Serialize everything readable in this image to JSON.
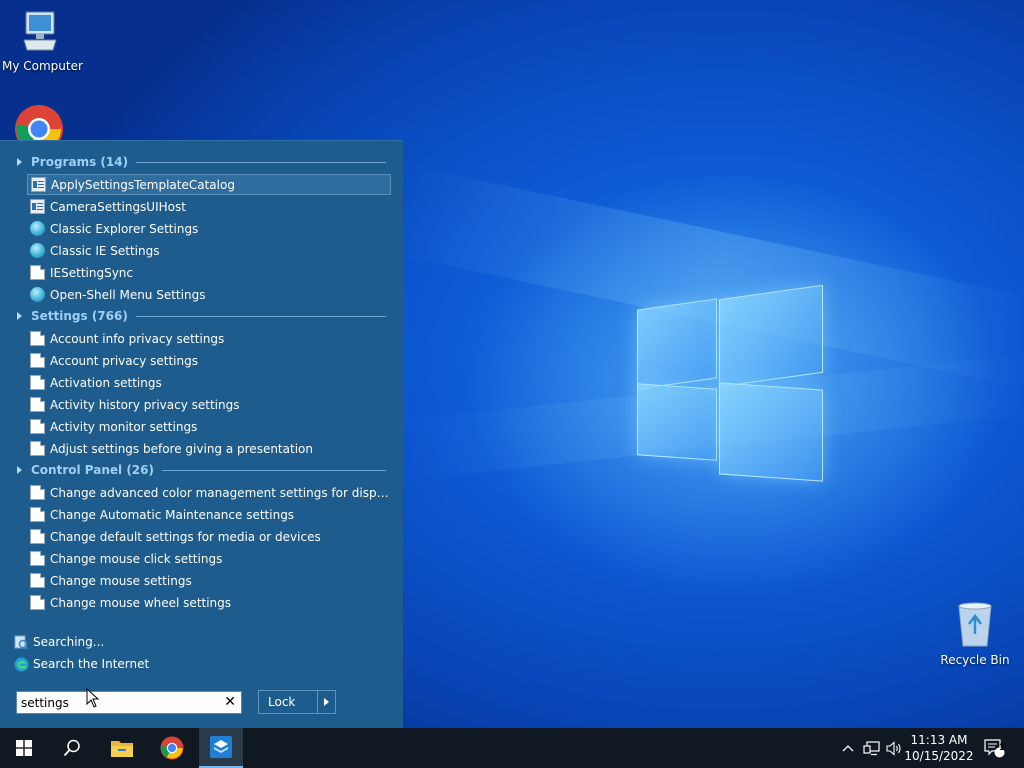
{
  "desktop": {
    "icons": [
      {
        "label": "My Computer"
      },
      {
        "label": "Recycle Bin"
      }
    ]
  },
  "start_menu": {
    "sections": [
      {
        "header": "Programs (14)",
        "items": [
          {
            "label": "ApplySettingsTemplateCatalog",
            "icon": "app-window-icon"
          },
          {
            "label": "CameraSettingsUIHost",
            "icon": "app-window-icon"
          },
          {
            "label": "Classic Explorer Settings",
            "icon": "open-shell-icon"
          },
          {
            "label": "Classic IE Settings",
            "icon": "open-shell-icon"
          },
          {
            "label": "IESettingSync",
            "icon": "document-icon"
          },
          {
            "label": "Open-Shell Menu Settings",
            "icon": "open-shell-icon"
          }
        ]
      },
      {
        "header": "Settings (766)",
        "items": [
          {
            "label": "Account info privacy settings",
            "icon": "document-icon"
          },
          {
            "label": "Account privacy settings",
            "icon": "document-icon"
          },
          {
            "label": "Activation settings",
            "icon": "document-icon"
          },
          {
            "label": "Activity history privacy settings",
            "icon": "document-icon"
          },
          {
            "label": "Activity monitor settings",
            "icon": "document-icon"
          },
          {
            "label": "Adjust settings before giving a presentation",
            "icon": "document-icon"
          }
        ]
      },
      {
        "header": "Control Panel (26)",
        "items": [
          {
            "label": "Change advanced color management settings for displays, sca...",
            "icon": "document-icon"
          },
          {
            "label": "Change Automatic Maintenance settings",
            "icon": "document-icon"
          },
          {
            "label": "Change default settings for media or devices",
            "icon": "document-icon"
          },
          {
            "label": "Change mouse click settings",
            "icon": "document-icon"
          },
          {
            "label": "Change mouse settings",
            "icon": "document-icon"
          },
          {
            "label": "Change mouse wheel settings",
            "icon": "document-icon"
          }
        ]
      }
    ],
    "searching_label": "Searching...",
    "search_internet_label": "Search the Internet",
    "search": {
      "value": "settings"
    },
    "lock_label": "Lock"
  },
  "taskbar": {
    "apps": [
      "start-icon",
      "search-icon",
      "file-explorer-icon",
      "chrome-icon",
      "open-shell-settings-icon"
    ],
    "clock": {
      "time": "11:13 AM",
      "date": "10/15/2022"
    },
    "notifications_count": "1"
  }
}
